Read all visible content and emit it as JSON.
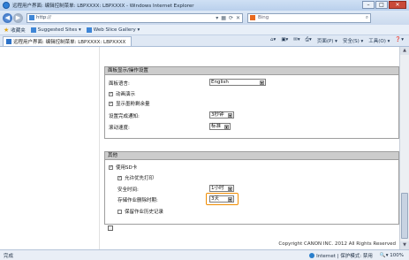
{
  "window": {
    "title": "远程用户界面: 编辑控制菜单: LBPXXXX: LBPXXXX - Windows Internet Explorer"
  },
  "addressbar": {
    "url": "http://",
    "search_placeholder": "Bing"
  },
  "favorites": {
    "label": "收藏夹",
    "items": [
      "Suggested Sites ▾",
      "Web Slice Gallery ▾"
    ]
  },
  "tab": {
    "label": "远程用户界面: 编辑控制菜单: LBPXXXX: LBPXXXX"
  },
  "commandbar": {
    "items": [
      "页面(P) ▾",
      "安全(S) ▾",
      "工具(O) ▾",
      "❓▾"
    ]
  },
  "section1": {
    "title": "面板显示/操作设置",
    "language_label": "面板语言:",
    "language_value": "English",
    "anim_label": "动画演示",
    "remaining_label": "显示墨粉剩余量",
    "notify_label": "设置完成通知:",
    "notify_value": "3秒钟",
    "scroll_label": "滚动速度:",
    "scroll_value": "标准"
  },
  "section2": {
    "title": "其他",
    "sd_label": "使用SD卡",
    "allow_print_label": "允许优先打印",
    "security_label": "安全时间:",
    "security_value": "1小时",
    "store_label": "存储作业删除时期:",
    "store_value": "3天",
    "history_label": "保留作业历史记录"
  },
  "footer": {
    "copyright": "Copyright CANON INC. 2012 All Rights Reserved"
  },
  "status": {
    "left": "完成",
    "zone": "Internet | 保护模式: 禁用",
    "zoom": "100%"
  }
}
